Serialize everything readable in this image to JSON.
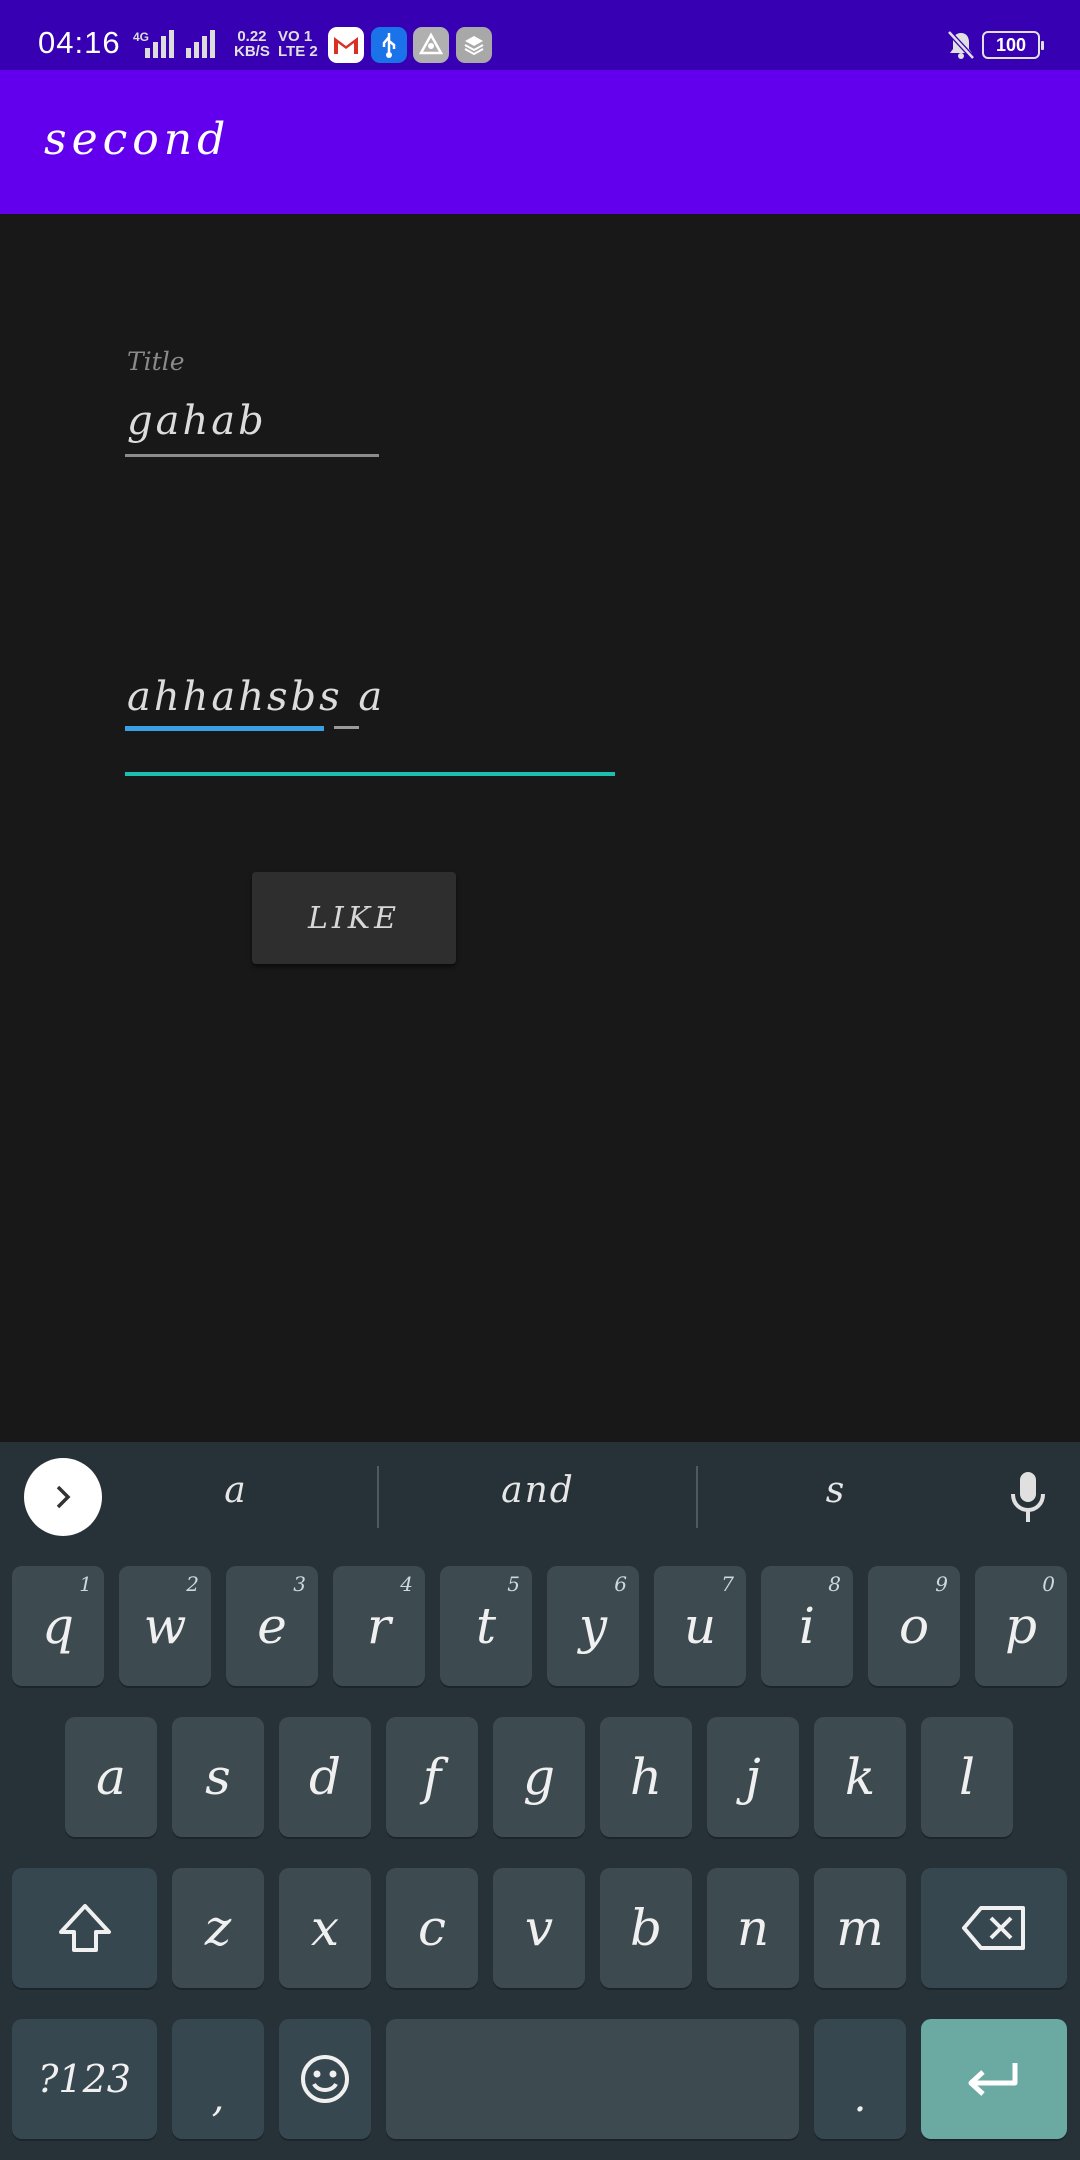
{
  "status_bar": {
    "time": "04:16",
    "network_type": "4G",
    "speed_value": "0.22",
    "speed_unit": "KB/S",
    "volte_top": "VO 1",
    "volte_bottom": "LTE 2",
    "battery": "100",
    "notification_icons": [
      "gmail-icon",
      "usb-icon",
      "app-icon",
      "stack-icon"
    ]
  },
  "app_bar": {
    "title": "second"
  },
  "form": {
    "title_label": "Title",
    "title_value": "gahab",
    "body_value": "ahhahsbs a",
    "like_button": "LIKE"
  },
  "keyboard": {
    "suggestions": [
      "a",
      "and",
      "s"
    ],
    "rows": [
      [
        {
          "k": "q",
          "h": "1"
        },
        {
          "k": "w",
          "h": "2"
        },
        {
          "k": "e",
          "h": "3"
        },
        {
          "k": "r",
          "h": "4"
        },
        {
          "k": "t",
          "h": "5"
        },
        {
          "k": "y",
          "h": "6"
        },
        {
          "k": "u",
          "h": "7"
        },
        {
          "k": "i",
          "h": "8"
        },
        {
          "k": "o",
          "h": "9"
        },
        {
          "k": "p",
          "h": "0"
        }
      ],
      [
        {
          "k": "a"
        },
        {
          "k": "s"
        },
        {
          "k": "d"
        },
        {
          "k": "f"
        },
        {
          "k": "g"
        },
        {
          "k": "h"
        },
        {
          "k": "j"
        },
        {
          "k": "k"
        },
        {
          "k": "l"
        }
      ],
      [
        {
          "k": "z"
        },
        {
          "k": "x"
        },
        {
          "k": "c"
        },
        {
          "k": "v"
        },
        {
          "k": "b"
        },
        {
          "k": "n"
        },
        {
          "k": "m"
        }
      ]
    ],
    "symbols_key": "?123",
    "comma_key": ",",
    "period_key": ".",
    "colors": {
      "background": "#263238",
      "key": "#3d4a50",
      "enter": "#6aaaa3"
    }
  },
  "colors": {
    "status_bar": "#3700b3",
    "app_bar": "#6200ee",
    "background": "#181818",
    "accent_underline": "#1dbfb0"
  }
}
